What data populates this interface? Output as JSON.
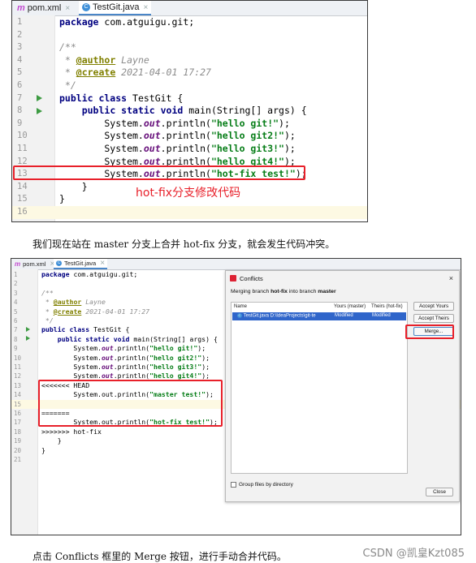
{
  "panel1": {
    "tabs": [
      {
        "icon": "m",
        "label": "pom.xml"
      },
      {
        "icon": "c",
        "label": "TestGit.java"
      }
    ],
    "lines": [
      {
        "n": "1",
        "html": "<span class=\"kw\">package</span> com.atguigu.git;"
      },
      {
        "n": "2",
        "html": ""
      },
      {
        "n": "3",
        "html": "<span class=\"cm\">/**</span>"
      },
      {
        "n": "4",
        "html": "<span class=\"cm\"> * </span><span class=\"tag\">@author</span><span class=\"cm\"> Layne</span>"
      },
      {
        "n": "5",
        "html": "<span class=\"cm\"> * </span><span class=\"tag\">@create</span><span class=\"cm\"> 2021-04-01 17:27</span>"
      },
      {
        "n": "6",
        "html": "<span class=\"cm\"> */</span>"
      },
      {
        "n": "7",
        "html": "<span class=\"kw\">public class</span> TestGit {"
      },
      {
        "n": "8",
        "html": "    <span class=\"kw\">public static void</span> main(String[] args) {"
      },
      {
        "n": "9",
        "html": "        System.<span class=\"fld\">out</span>.println(<span class=\"st\">\"hello git!\"</span>);"
      },
      {
        "n": "10",
        "html": "        System.<span class=\"fld\">out</span>.println(<span class=\"st\">\"hello git2!\"</span>);"
      },
      {
        "n": "11",
        "html": "        System.<span class=\"fld\">out</span>.println(<span class=\"st\">\"hello git3!\"</span>);"
      },
      {
        "n": "12",
        "html": "        System.<span class=\"fld\">out</span>.println(<span class=\"st\">\"hello git4!\"</span>);"
      },
      {
        "n": "13",
        "html": "        System.<span class=\"fld\">out</span>.println(<span class=\"st\">\"hot-fix test!\"</span>);"
      },
      {
        "n": "14",
        "html": "    }"
      },
      {
        "n": "15",
        "html": "}"
      },
      {
        "n": "16",
        "html": ""
      }
    ],
    "annotation": "hot-fix分支修改代码"
  },
  "paragraph1": "我们现在站在 master 分支上合并 hot-fix 分支，就会发生代码冲突。",
  "panel2": {
    "tabs": [
      {
        "icon": "m",
        "label": "pom.xml"
      },
      {
        "icon": "c",
        "label": "TestGit.java"
      }
    ],
    "lines": [
      {
        "n": "1",
        "html": "<span class=\"kw\">package</span> com.atguigu.git;"
      },
      {
        "n": "2",
        "html": ""
      },
      {
        "n": "3",
        "html": "<span class=\"cm\">/**</span>"
      },
      {
        "n": "4",
        "html": "<span class=\"cm\"> * </span><span class=\"tag\">@author</span><span class=\"cm\"> Layne</span>"
      },
      {
        "n": "5",
        "html": "<span class=\"cm\"> * </span><span class=\"tag\">@create</span><span class=\"cm\"> 2021-04-01 17:27</span>"
      },
      {
        "n": "6",
        "html": "<span class=\"cm\"> */</span>"
      },
      {
        "n": "7",
        "html": "<span class=\"kw\">public class</span> TestGit {"
      },
      {
        "n": "8",
        "html": "    <span class=\"kw\">public static void</span> main(String[] args) {"
      },
      {
        "n": "9",
        "html": "        System.<span class=\"fld\">out</span>.println(<span class=\"st\">\"hello git!\"</span>);"
      },
      {
        "n": "10",
        "html": "        System.<span class=\"fld\">out</span>.println(<span class=\"st\">\"hello git2!\"</span>);"
      },
      {
        "n": "11",
        "html": "        System.<span class=\"fld\">out</span>.println(<span class=\"st\">\"hello git3!\"</span>);"
      },
      {
        "n": "12",
        "html": "        System.<span class=\"fld\">out</span>.println(<span class=\"st\">\"hello git4!\"</span>);"
      },
      {
        "n": "13",
        "html": "&lt;&lt;&lt;&lt;&lt;&lt;&lt; HEAD"
      },
      {
        "n": "14",
        "html": "        System.out.println(<span class=\"st\">\"master test!\"</span>);"
      },
      {
        "n": "15",
        "html": ""
      },
      {
        "n": "16",
        "html": "======="
      },
      {
        "n": "17",
        "html": "        System.out.println(<span class=\"st\">\"hot-fix test!\"</span>);"
      },
      {
        "n": "18",
        "html": "&gt;&gt;&gt;&gt;&gt;&gt;&gt; hot-fix"
      },
      {
        "n": "19",
        "html": "    }"
      },
      {
        "n": "20",
        "html": "}"
      },
      {
        "n": "21",
        "html": ""
      }
    ]
  },
  "dialog": {
    "title": "Conflicts",
    "close": "×",
    "message_pre": "Merging branch ",
    "message_branch": "hot-fix",
    "message_mid": " into branch ",
    "message_target": "master",
    "col_name": "Name",
    "col_yours": "Yours (master)",
    "col_theirs": "Theirs (hot-fix)",
    "row_file": "TestGit.java",
    "row_path": "D:\\IdeaProjects\\git-te",
    "row_yours": "Modified",
    "row_theirs": "Modified",
    "btn_accept_yours": "Accept Yours",
    "btn_accept_theirs": "Accept Theirs",
    "btn_merge": "Merge...",
    "checkbox_label": "Group files by directory",
    "btn_close": "Close"
  },
  "paragraph2": "点击 Conflicts 框里的 Merge 按钮，进行手动合并代码。",
  "watermark": "CSDN @凯皇Kzt085"
}
